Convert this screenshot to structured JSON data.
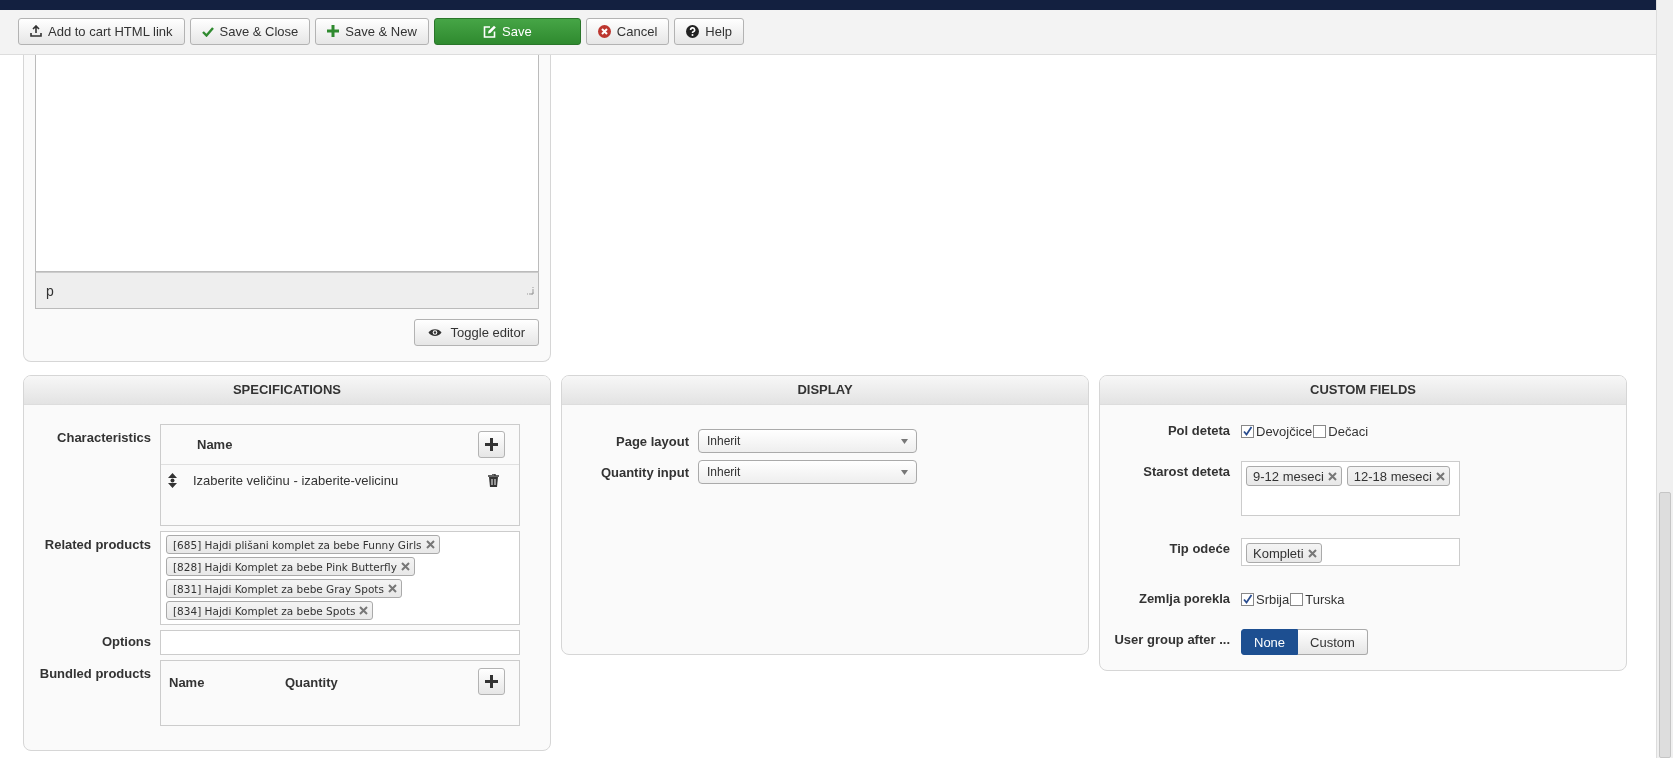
{
  "toolbar": {
    "buttons": [
      {
        "label": "Add to cart HTML link",
        "kind": "upload",
        "primary": false
      },
      {
        "label": "Save & Close",
        "kind": "check",
        "primary": false
      },
      {
        "label": "Save & New",
        "kind": "plus",
        "primary": false
      },
      {
        "label": "Save",
        "kind": "edit",
        "primary": true
      },
      {
        "label": "Cancel",
        "kind": "cancel",
        "primary": false
      },
      {
        "label": "Help",
        "kind": "help",
        "primary": false
      }
    ]
  },
  "editor": {
    "path": "p",
    "toggle_button": "Toggle editor"
  },
  "specifications": {
    "title": "SPECIFICATIONS",
    "characteristics": {
      "label": "Characteristics",
      "column": "Name",
      "rows": [
        "Izaberite veličinu - izaberite-velicinu"
      ]
    },
    "related_products": {
      "label": "Related products",
      "tags": [
        "[685] Hajdi plišani komplet za bebe Funny Girls",
        "[828] Hajdi Komplet za bebe Pink Butterfly",
        "[831] Hajdi Komplet za bebe Gray Spots",
        "[834] Hajdi Komplet za bebe Spots"
      ]
    },
    "options": {
      "label": "Options"
    },
    "bundled_products": {
      "label": "Bundled products",
      "columns": [
        "Name",
        "Quantity"
      ]
    }
  },
  "display": {
    "title": "DISPLAY",
    "fields": [
      {
        "label": "Page layout",
        "value": "Inherit"
      },
      {
        "label": "Quantity input",
        "value": "Inherit"
      }
    ]
  },
  "custom_fields": {
    "title": "CUSTOM FIELDS",
    "fields": [
      {
        "kind": "checkboxes",
        "label": "Pol deteta",
        "options": [
          {
            "label": "Devojčice",
            "checked": true
          },
          {
            "label": "Dečaci",
            "checked": false
          }
        ]
      },
      {
        "kind": "tag-list",
        "label": "Starost deteta",
        "tags": [
          "9-12 meseci",
          "12-18 meseci"
        ]
      },
      {
        "kind": "tag-input",
        "label": "Tip odeće",
        "tags": [
          "Kompleti"
        ]
      },
      {
        "kind": "checkboxes",
        "label": "Zemlja porekla",
        "options": [
          {
            "label": "Srbija",
            "checked": true
          },
          {
            "label": "Turska",
            "checked": false
          }
        ]
      },
      {
        "kind": "toggle",
        "label": "User group after ...",
        "options": [
          {
            "label": "None",
            "selected": true
          },
          {
            "label": "Custom",
            "selected": false
          }
        ]
      }
    ]
  }
}
